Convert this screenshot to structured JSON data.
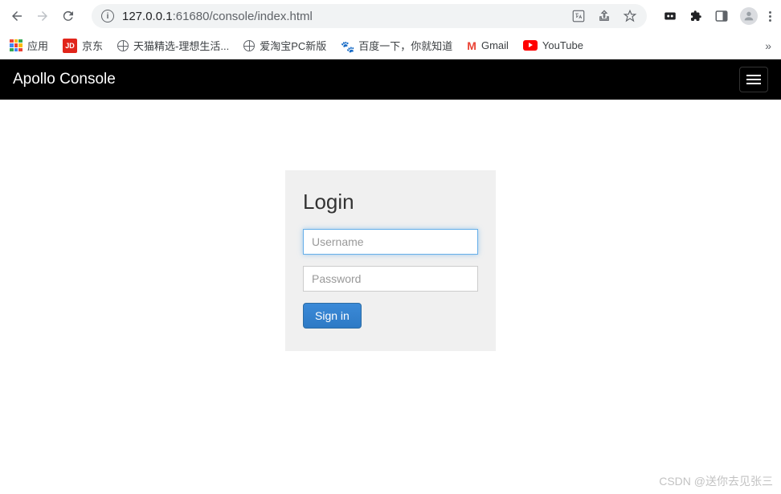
{
  "browser": {
    "url_host": "127.0.0.1",
    "url_port_path": ":61680/console/index.html"
  },
  "bookmarks": {
    "apps_label": "应用",
    "jd_label": "京东",
    "tmall_label": "天猫精选-理想生活...",
    "aitaobao_label": "爱淘宝PC新版",
    "baidu_label": "百度一下，你就知道",
    "gmail_label": "Gmail",
    "youtube_label": "YouTube"
  },
  "navbar": {
    "brand": "Apollo Console"
  },
  "login": {
    "title": "Login",
    "username_placeholder": "Username",
    "username_value": "",
    "password_placeholder": "Password",
    "password_value": "",
    "signin_label": "Sign in"
  },
  "watermark": "CSDN @送你去见张三"
}
